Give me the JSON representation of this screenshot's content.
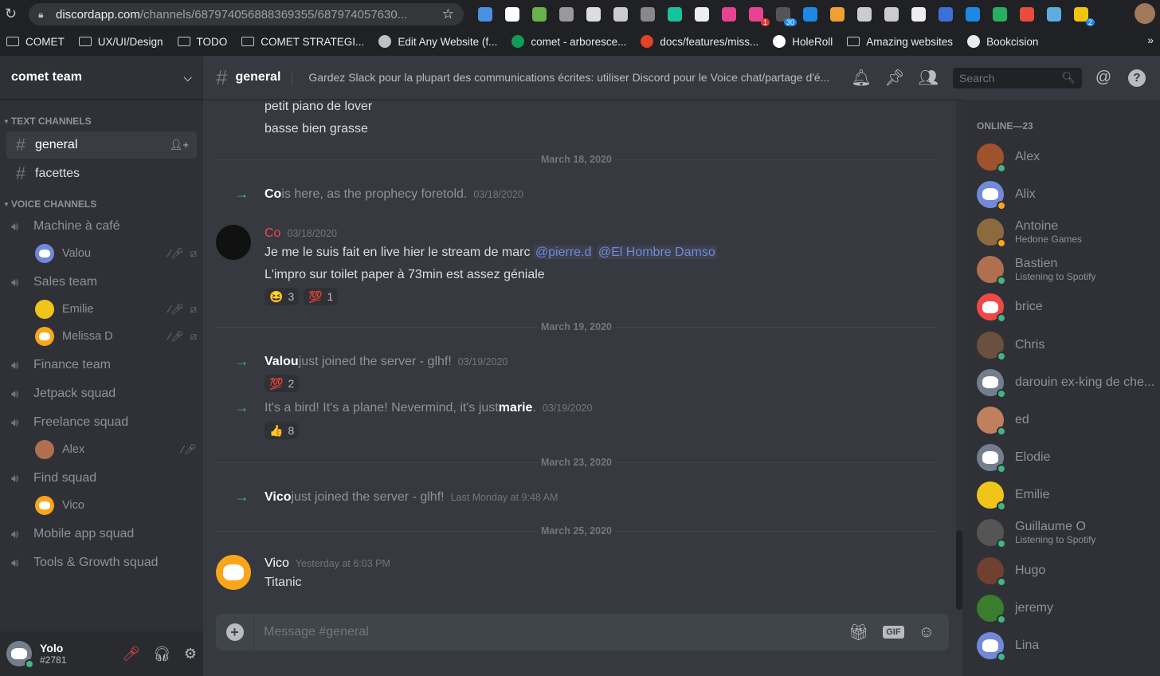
{
  "browser": {
    "url_host": "discordapp.com",
    "url_path": "/channels/687974056888369355/687974057630...",
    "extensions": [
      "diamond",
      "instapaper",
      "apple",
      "fx",
      "lma",
      "camera",
      "info",
      "grammarly",
      "layers",
      "spiral",
      "pocket",
      "notification",
      "lh",
      "box",
      "w",
      "link",
      "bh",
      "calendar",
      "download",
      "shield",
      "fire",
      "translate",
      "hand"
    ],
    "ext_badges": {
      "pocket": "1",
      "notification": "30",
      "hand": "2"
    },
    "bookmarks": [
      {
        "label": "COMET",
        "icon": "folder-icon"
      },
      {
        "label": "UX/UI/Design",
        "icon": "folder-icon"
      },
      {
        "label": "TODO",
        "icon": "folder-icon"
      },
      {
        "label": "COMET STRATEGI...",
        "icon": "folder-icon"
      },
      {
        "label": "Edit Any Website (f...",
        "icon": "star-icon"
      },
      {
        "label": "comet - arboresce...",
        "icon": "sheets-icon"
      },
      {
        "label": "docs/features/miss...",
        "icon": "gitlab-icon"
      },
      {
        "label": "HoleRoll",
        "icon": "holeroll-icon"
      },
      {
        "label": "Amazing websites",
        "icon": "folder-icon"
      },
      {
        "label": "Bookcision",
        "icon": "globe-icon"
      }
    ]
  },
  "guild": {
    "name": "comet team",
    "text_header": "TEXT CHANNELS",
    "voice_header": "VOICE CHANNELS",
    "text_channels": [
      "general",
      "facettes"
    ],
    "voice": [
      {
        "name": "Machine à café",
        "users": [
          {
            "name": "Valou",
            "color": "#7289da",
            "muted": true
          }
        ]
      },
      {
        "name": "Sales team",
        "users": [
          {
            "name": "Emilie",
            "color": "#f0c419",
            "muted": true
          },
          {
            "name": "Melissa D",
            "color": "#faa61a",
            "muted": true
          }
        ]
      },
      {
        "name": "Finance team",
        "users": []
      },
      {
        "name": "Jetpack squad",
        "users": []
      },
      {
        "name": "Freelance squad",
        "users": [
          {
            "name": "Alex",
            "color": "#b07050",
            "muted": true
          }
        ]
      },
      {
        "name": "Find squad",
        "users": [
          {
            "name": "Vico",
            "color": "#faa61a",
            "muted": false
          }
        ]
      },
      {
        "name": "Mobile app squad",
        "users": []
      },
      {
        "name": "Tools & Growth squad",
        "users": []
      }
    ]
  },
  "user": {
    "name": "Yolo",
    "tag": "#2781"
  },
  "channel": {
    "name": "general",
    "topic": "Gardez Slack pour la plupart des communications écrites: utiliser Discord pour le Voice chat/partage d'é...",
    "search_placeholder": "Search",
    "composer_placeholder": "Message #general"
  },
  "messages": {
    "prev_line1": "petit piano de lover",
    "prev_line2": "basse bien grasse",
    "div1": "March 18, 2020",
    "sys1_name": "Co",
    "sys1_text": " is here, as the prophecy foretold.",
    "sys1_ts": "03/18/2020",
    "co_author": "Co",
    "co_ts": "03/18/2020",
    "co_text": "Je me le suis fait en live hier le stream de marc ",
    "co_mention1": "@pierre.d",
    "co_mention2": "@El Hombre Damso",
    "co_line2": "L'impro sur toilet paper à 73min est assez géniale",
    "react1_emoji": "😆",
    "react1_count": "3",
    "react2_emoji": "💯",
    "react2_count": "1",
    "div2": "March 19, 2020",
    "sys2_name": "Valou",
    "sys2_text": " just joined the server - glhf!",
    "sys2_ts": "03/19/2020",
    "react3_emoji": "💯",
    "react3_count": "2",
    "sys3_text": "It's a bird! It's a plane! Nevermind, it's just ",
    "sys3_name": "marie",
    "sys3_ts": "03/19/2020",
    "react4_emoji": "👍",
    "react4_count": "8",
    "div3": "March 23, 2020",
    "sys4_name": "Vico",
    "sys4_text": " just joined the server - glhf!",
    "sys4_ts": "Last Monday at 9:48 AM",
    "div4": "March 25, 2020",
    "vico_author": "Vico",
    "vico_ts": "Yesterday at 6:03 PM",
    "vico_text": "Titanic"
  },
  "members": {
    "title": "ONLINE—23",
    "list": [
      {
        "name": "Alex",
        "status": "",
        "color": "#a0522d",
        "dot": "online"
      },
      {
        "name": "Alix",
        "status": "",
        "color": "#7289da",
        "dot": "idle"
      },
      {
        "name": "Antoine",
        "status": "Hedone Games",
        "color": "#8b6b3d",
        "dot": "idle"
      },
      {
        "name": "Bastien",
        "status": "Listening to Spotify",
        "color": "#b07050",
        "dot": "online"
      },
      {
        "name": "brice",
        "status": "",
        "color": "#f04747",
        "dot": "online"
      },
      {
        "name": "Chris",
        "status": "",
        "color": "#6b5040",
        "dot": "online"
      },
      {
        "name": "darouin ex-king de che...",
        "status": "",
        "color": "#747f8d",
        "dot": "online"
      },
      {
        "name": "ed",
        "status": "",
        "color": "#c08060",
        "dot": "online"
      },
      {
        "name": "Elodie",
        "status": "",
        "color": "#747f8d",
        "dot": "online"
      },
      {
        "name": "Emilie",
        "status": "",
        "color": "#f0c419",
        "dot": "online"
      },
      {
        "name": "Guillaume O",
        "status": "Listening to Spotify",
        "color": "#555555",
        "dot": "online"
      },
      {
        "name": "Hugo",
        "status": "",
        "color": "#704030",
        "dot": "online"
      },
      {
        "name": "jeremy",
        "status": "",
        "color": "#3a7d2c",
        "dot": "online"
      },
      {
        "name": "Lina",
        "status": "",
        "color": "#7289da",
        "dot": "online"
      }
    ]
  },
  "colors": {
    "accent": "#7289da",
    "online": "#43b581",
    "idle": "#faa61a",
    "co_author": "#f04747"
  }
}
